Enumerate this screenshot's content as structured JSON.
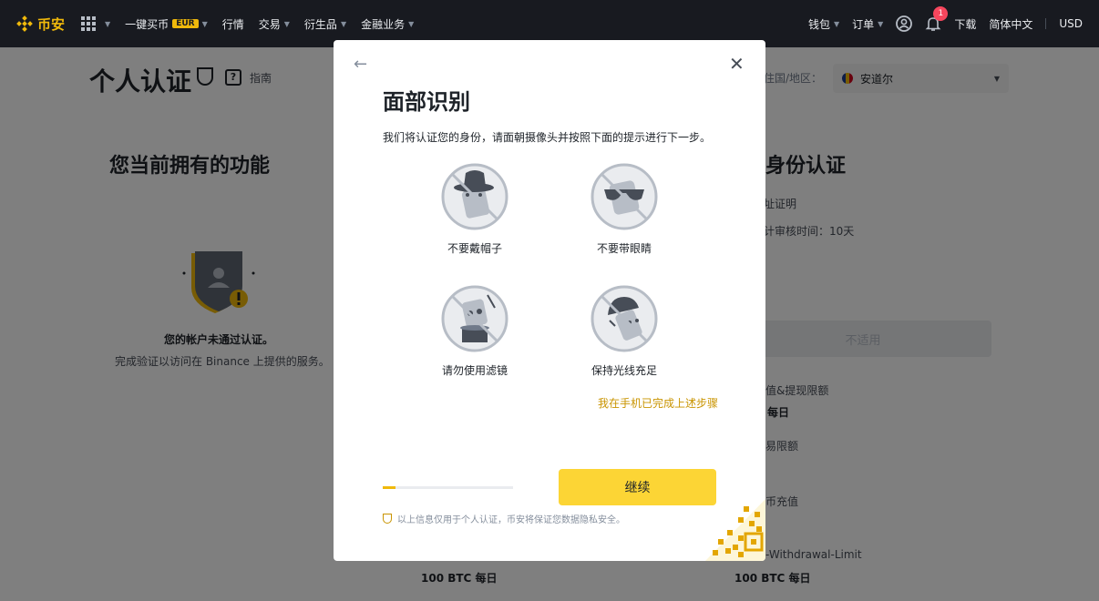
{
  "nav": {
    "logo_text": "币安",
    "buy_crypto": "一键买币",
    "buy_badge": "EUR",
    "markets": "行情",
    "trade": "交易",
    "derivatives": "衍生品",
    "finance": "金融业务",
    "wallet": "钱包",
    "orders": "订单",
    "notification_count": "1",
    "download": "下载",
    "language": "简体中文",
    "currency": "USD"
  },
  "page": {
    "title": "个人认证",
    "guide": "指南",
    "country_label": "住国/地区：",
    "country_value": "安道尔",
    "left_heading": "您当前拥有的功能",
    "not_verified": "您的帐户未通过认证。",
    "verify_hint": "完成验证以访问在 Binance 上提供的服务。",
    "right_heading": "阶身份认证",
    "right_line1": "址证明",
    "right_line2": "计审核时间：10天",
    "not_applicable": "不适用",
    "limit1": "值&提现限额",
    "limit1_value": "每日",
    "limit2": "易限额",
    "limit3": "币充值",
    "limit4": "-Withdrawal-Limit",
    "bottom_left_value": "100 BTC 每日",
    "bottom_right_value": "100 BTC 每日"
  },
  "modal": {
    "title": "面部识别",
    "description": "我们将认证您的身份，请面朝摄像头并按照下面的提示进行下一步。",
    "tips": [
      {
        "label": "不要戴帽子",
        "icon": "no-hat-icon"
      },
      {
        "label": "不要带眼睛",
        "icon": "no-glasses-icon"
      },
      {
        "label": "请勿使用滤镜",
        "icon": "no-filter-icon"
      },
      {
        "label": "保持光线充足",
        "icon": "good-lighting-icon"
      }
    ],
    "done_on_phone": "我在手机已完成上述步骤",
    "progress": 0.1,
    "continue": "继续",
    "privacy_note": "以上信息仅用于个人认证，币安将保证您数据隐私安全。"
  },
  "colors": {
    "brand": "#f0b90b",
    "button": "#fcd535",
    "link": "#c99400",
    "nav_bg": "#181a20"
  }
}
